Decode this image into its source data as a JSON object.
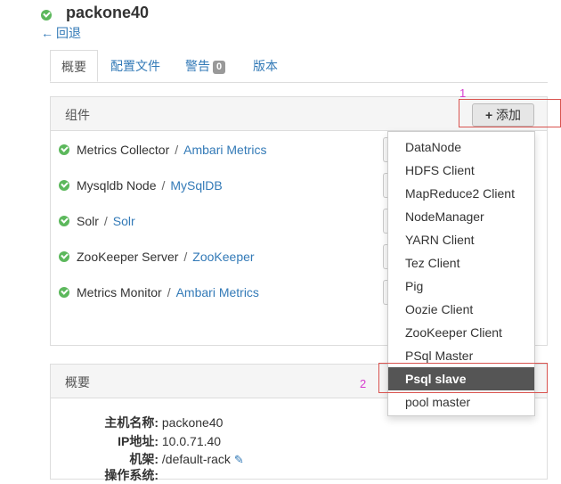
{
  "host": {
    "title": "packone40",
    "back": "回退"
  },
  "tabs": [
    {
      "label": "概要"
    },
    {
      "label": "配置文件"
    },
    {
      "label": "警告",
      "badge": "0"
    },
    {
      "label": "版本"
    }
  ],
  "components_panel": {
    "title": "组件",
    "add_button": "添加",
    "items": [
      {
        "name": "Metrics Collector",
        "service": "Ambari Metrics"
      },
      {
        "name": "Mysqldb Node",
        "service": "MySqlDB"
      },
      {
        "name": "Solr",
        "service": "Solr"
      },
      {
        "name": "ZooKeeper Server",
        "service": "ZooKeeper"
      },
      {
        "name": "Metrics Monitor",
        "service": "Ambari Metrics"
      }
    ]
  },
  "separator": "/",
  "add_menu": {
    "items": [
      "DataNode",
      "HDFS Client",
      "MapReduce2 Client",
      "NodeManager",
      "YARN Client",
      "Tez Client",
      "Pig",
      "Oozie Client",
      "ZooKeeper Client",
      "PSql Master",
      "Psql slave",
      "pool master"
    ],
    "highlighted": "Psql slave"
  },
  "annotations": {
    "one": "1",
    "two": "2"
  },
  "summary_panel": {
    "title": "概要",
    "host_name_label": "主机名称:",
    "host_name": "packone40",
    "ip_label": "IP地址:",
    "ip": "10.0.71.40",
    "rack_label": "机架:",
    "rack": "/default-rack",
    "next_label": "操作系统:"
  },
  "colors": {
    "ok": "#5cb85c",
    "link": "#337ab7",
    "annotation": "#d63ccf",
    "highlight_box": "#d9534f"
  }
}
